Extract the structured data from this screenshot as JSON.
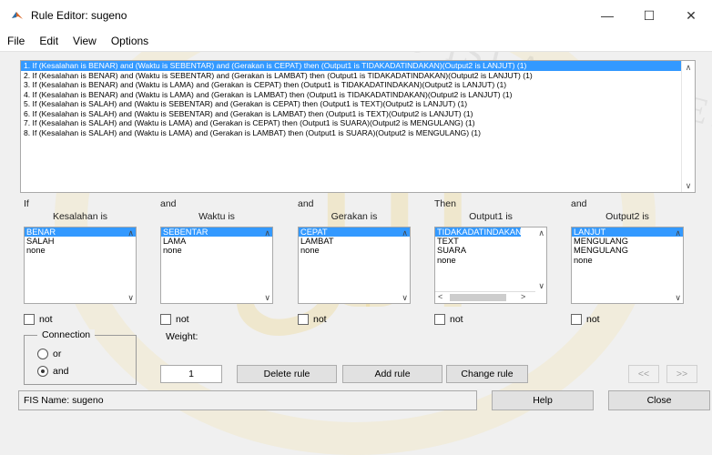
{
  "window": {
    "title": "Rule Editor: sugeno",
    "controls": [
      "—",
      "☐",
      "✕"
    ]
  },
  "menu": [
    "File",
    "Edit",
    "View",
    "Options"
  ],
  "rules": [
    "1. If (Kesalahan is BENAR) and (Waktu is SEBENTAR) and (Gerakan is CEPAT) then (Output1 is TIDAKADATINDAKAN)(Output2 is LANJUT) (1)",
    "2. If (Kesalahan is BENAR) and (Waktu is SEBENTAR) and (Gerakan is LAMBAT) then (Output1 is TIDAKADATINDAKAN)(Output2 is LANJUT) (1)",
    "3. If (Kesalahan is BENAR) and (Waktu is LAMA) and (Gerakan is CEPAT) then (Output1 is TIDAKADATINDAKAN)(Output2 is LANJUT) (1)",
    "4. If (Kesalahan is BENAR) and (Waktu is LAMA) and (Gerakan is LAMBAT) then (Output1 is TIDAKADATINDAKAN)(Output2 is LANJUT) (1)",
    "5. If (Kesalahan is SALAH) and (Waktu is SEBENTAR) and (Gerakan is CEPAT) then (Output1 is TEXT)(Output2 is LANJUT) (1)",
    "6. If (Kesalahan is SALAH) and (Waktu is SEBENTAR) and (Gerakan is LAMBAT) then (Output1 is TEXT)(Output2 is LANJUT) (1)",
    "7. If (Kesalahan is SALAH) and (Waktu is LAMA) and (Gerakan is CEPAT) then (Output1 is SUARA)(Output2 is MENGULANG) (1)",
    "8. If (Kesalahan is SALAH) and (Waktu is LAMA) and (Gerakan is LAMBAT) then (Output1 is SUARA)(Output2 is MENGULANG) (1)"
  ],
  "columns": [
    {
      "connector": "If",
      "variable": "Kesalahan is",
      "items": [
        "BENAR",
        "SALAH",
        "none"
      ],
      "not_label": "not"
    },
    {
      "connector": "and",
      "variable": "Waktu is",
      "items": [
        "SEBENTAR",
        "LAMA",
        "none"
      ],
      "not_label": "not"
    },
    {
      "connector": "and",
      "variable": "Gerakan is",
      "items": [
        "CEPAT",
        "LAMBAT",
        "none"
      ],
      "not_label": "not"
    },
    {
      "connector": "Then",
      "variable": "Output1 is",
      "items": [
        "TIDAKADATINDAKAN",
        "TEXT",
        "SUARA",
        "none"
      ],
      "not_label": "not"
    },
    {
      "connector": "and",
      "variable": "Output2 is",
      "items": [
        "LANJUT",
        "MENGULANG",
        "MENGULANG",
        "none"
      ],
      "not_label": "not"
    }
  ],
  "connection": {
    "label": "Connection",
    "options": [
      "or",
      "and"
    ],
    "selected": "and"
  },
  "weight": {
    "label": "Weight:",
    "value": "1"
  },
  "buttons": {
    "delete": "Delete rule",
    "add": "Add rule",
    "change": "Change rule",
    "prev": "<<",
    "next": ">>",
    "help": "Help",
    "close": "Close"
  },
  "status": "FIS Name: sugeno",
  "watermark": "UNIVERSITAS ISLAM NEGERI",
  "colors": {
    "selection": "#3399ff",
    "background": "#f0f0f0"
  }
}
